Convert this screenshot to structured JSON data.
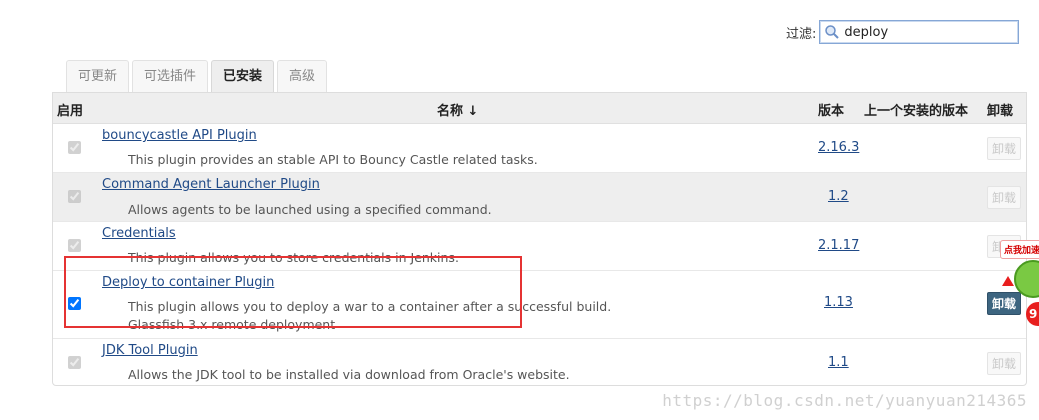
{
  "filter": {
    "label": "过滤:",
    "value": "deploy",
    "icon": "search-icon"
  },
  "tabs": [
    {
      "label": "可更新",
      "active": false
    },
    {
      "label": "可选插件",
      "active": false
    },
    {
      "label": "已安装",
      "active": true
    },
    {
      "label": "高级",
      "active": false
    }
  ],
  "table": {
    "headers": {
      "enabled": "启用",
      "name": "名称 ↓",
      "version": "版本",
      "previous_version": "上一个安装的版本",
      "uninstall": "卸载"
    },
    "rows": [
      {
        "name": "bouncycastle API Plugin",
        "description": "This plugin provides an stable API to Bouncy Castle related tasks.",
        "version": "2.16.3",
        "enabled": true,
        "uninstall_label": "卸载"
      },
      {
        "name": "Command Agent Launcher Plugin",
        "description": "Allows agents to be launched using a specified command.",
        "version": "1.2",
        "enabled": true,
        "uninstall_label": "卸载"
      },
      {
        "name": "Credentials",
        "description": "This plugin allows you to store credentials in Jenkins.",
        "version": "2.1.17",
        "enabled": true,
        "uninstall_label": "卸载"
      },
      {
        "name": "Deploy to container Plugin",
        "description": "This plugin allows you to deploy a war to a container after a successful build.",
        "description2": "Glassfish 3.x remote deployment",
        "version": "1.13",
        "enabled": true,
        "uninstall_label": "卸载"
      },
      {
        "name": "JDK Tool Plugin",
        "description": "Allows the JDK tool to be installed via download from Oracle's website.",
        "version": "1.1",
        "enabled": true,
        "uninstall_label": "卸载"
      }
    ]
  },
  "ad": {
    "bubble_text": "点我加速",
    "badge_text": "9"
  },
  "watermark": "https://blog.csdn.net/yuanyuan214365",
  "colors": {
    "link": "#204a87",
    "highlight": "#e53333",
    "uninstall_active": "#3d6580"
  }
}
